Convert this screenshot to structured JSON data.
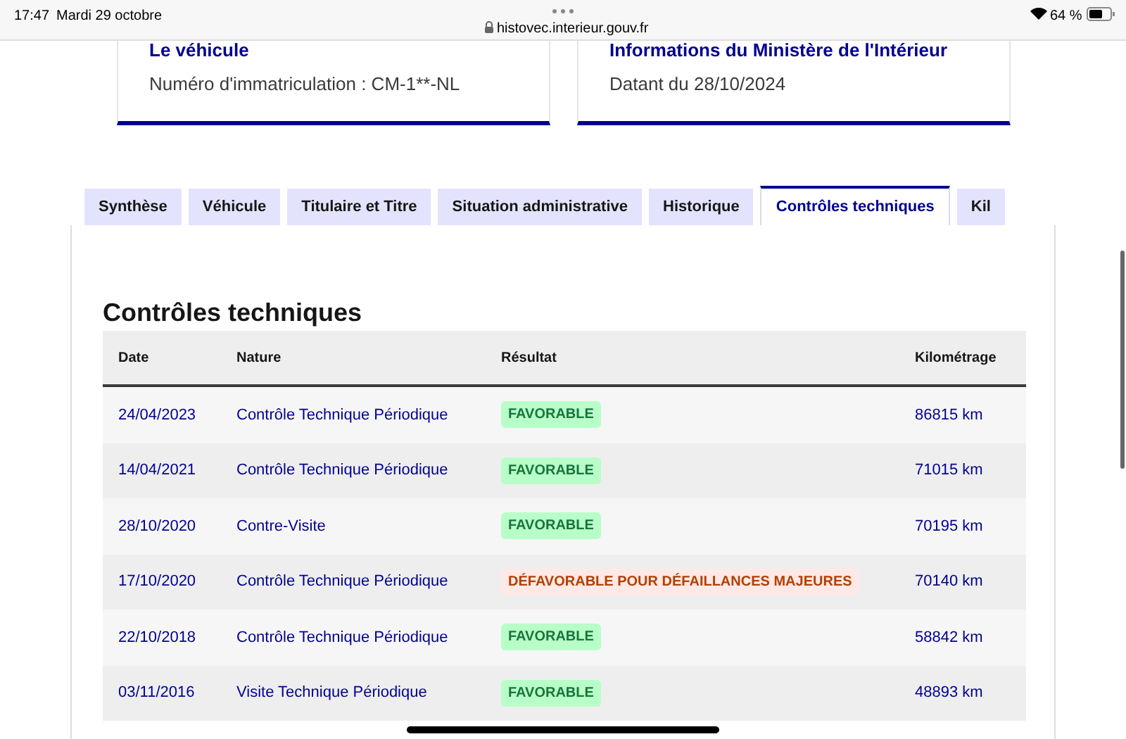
{
  "status_bar": {
    "time": "17:47",
    "date": "Mardi 29 octobre",
    "url": "histovec.interieur.gouv.fr",
    "battery": "64 %"
  },
  "cards": [
    {
      "title": "Le véhicule",
      "text": "Numéro d'immatriculation : CM-1**-NL"
    },
    {
      "title": "Informations du Ministère de l'Intérieur",
      "text": "Datant du 28/10/2024"
    }
  ],
  "tabs": [
    {
      "label": "Synthèse",
      "selected": false
    },
    {
      "label": "Véhicule",
      "selected": false
    },
    {
      "label": "Titulaire et Titre",
      "selected": false
    },
    {
      "label": "Situation administrative",
      "selected": false
    },
    {
      "label": "Historique",
      "selected": false
    },
    {
      "label": "Contrôles techniques",
      "selected": true
    },
    {
      "label": "Kil",
      "selected": false
    }
  ],
  "section_title": "Contrôles techniques",
  "table": {
    "columns": [
      "Date",
      "Nature",
      "Résultat",
      "Kilométrage"
    ],
    "rows": [
      {
        "date": "24/04/2023",
        "nature": "Contrôle Technique Périodique",
        "result": {
          "kind": "success",
          "label": "FAVORABLE"
        },
        "km": "86815 km"
      },
      {
        "date": "14/04/2021",
        "nature": "Contrôle Technique Périodique",
        "result": {
          "kind": "success",
          "label": "FAVORABLE"
        },
        "km": "71015 km"
      },
      {
        "date": "28/10/2020",
        "nature": "Contre-Visite",
        "result": {
          "kind": "success",
          "label": "FAVORABLE"
        },
        "km": "70195 km"
      },
      {
        "date": "17/10/2020",
        "nature": "Contrôle Technique Périodique",
        "result": {
          "kind": "error",
          "label": "DÉFAVORABLE POUR DÉFAILLANCES MAJEURES"
        },
        "km": "70140 km"
      },
      {
        "date": "22/10/2018",
        "nature": "Contrôle Technique Périodique",
        "result": {
          "kind": "success",
          "label": "FAVORABLE"
        },
        "km": "58842 km"
      },
      {
        "date": "03/11/2016",
        "nature": "Visite Technique Périodique",
        "result": {
          "kind": "success",
          "label": "FAVORABLE"
        },
        "km": "48893 km"
      }
    ]
  }
}
